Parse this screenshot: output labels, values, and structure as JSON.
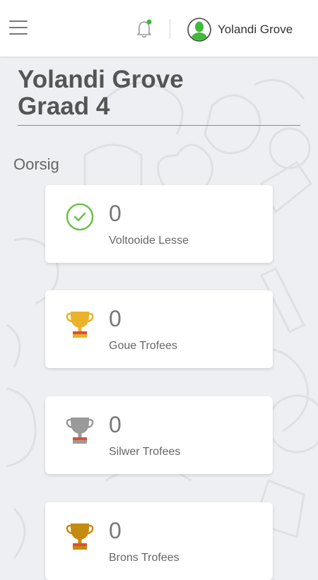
{
  "header": {
    "user_name": "Yolandi Grove",
    "notification_badge_color": "#3fba3a",
    "avatar_color": "#3fba3a",
    "menu_icon": "hamburger-menu-icon",
    "bell_icon": "bell-icon"
  },
  "student": {
    "name": "Yolandi Grove",
    "grade": "Graad 4"
  },
  "overview": {
    "title": "Oorsig",
    "cards": [
      {
        "value": "0",
        "label": "Voltooide Lesse",
        "icon": "check-circle-icon",
        "color": "#6cc04a"
      },
      {
        "value": "0",
        "label": "Goue Trofees",
        "icon": "gold-trophy-icon",
        "color": "#e9b22a"
      },
      {
        "value": "0",
        "label": "Silwer Trofees",
        "icon": "silver-trophy-icon",
        "color": "#9a9a9a"
      },
      {
        "value": "0",
        "label": "Brons Trofees",
        "icon": "bronze-trophy-icon",
        "color": "#c58a12"
      }
    ]
  }
}
